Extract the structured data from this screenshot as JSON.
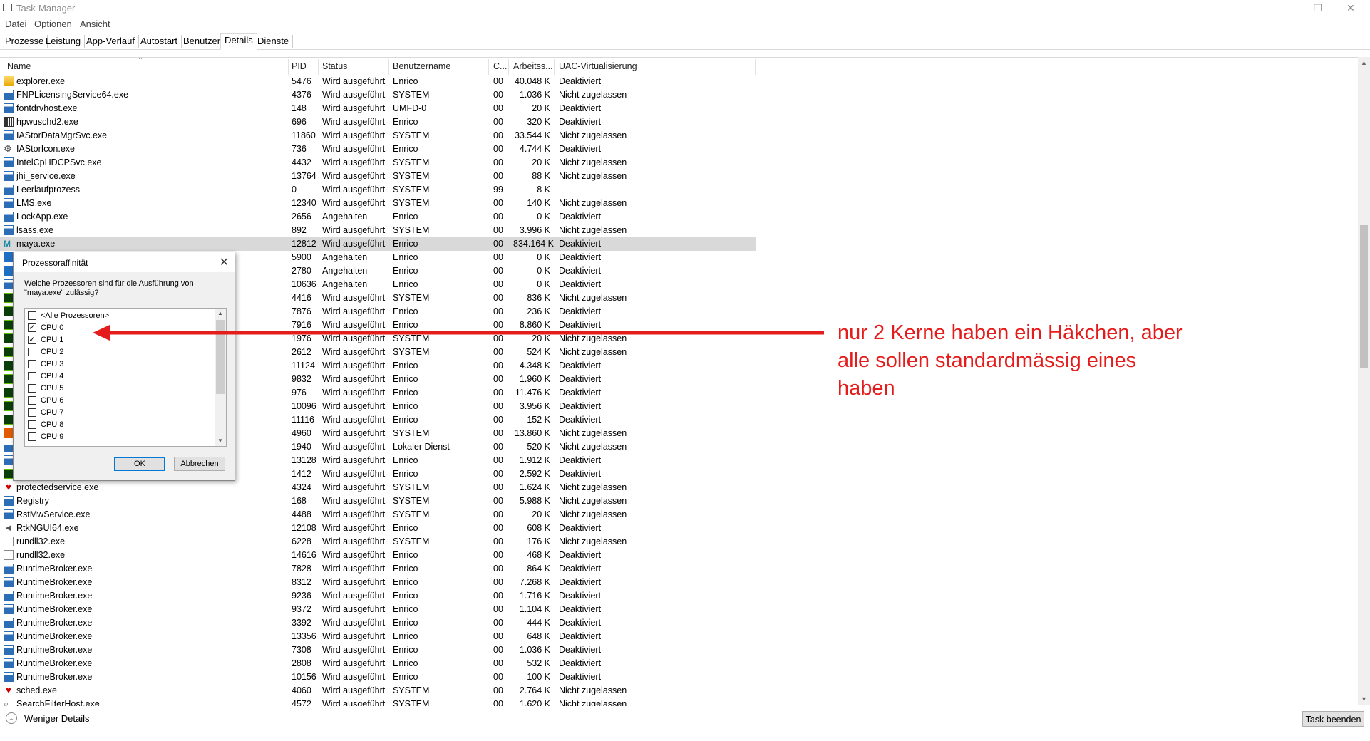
{
  "window": {
    "title": "Task-Manager",
    "minimize": "—",
    "restore": "❐",
    "close": "✕"
  },
  "menu": [
    "Datei",
    "Optionen",
    "Ansicht"
  ],
  "tabs": [
    "Prozesse",
    "Leistung",
    "App-Verlauf",
    "Autostart",
    "Benutzer",
    "Details",
    "Dienste"
  ],
  "active_tab": "Details",
  "columns": [
    "Name",
    "PID",
    "Status",
    "Benutzername",
    "C...",
    "Arbeitss...",
    "UAC-Virtualisierung"
  ],
  "processes": [
    {
      "icon": "folder-icon",
      "name": "explorer.exe",
      "pid": "5476",
      "status": "Wird ausgeführt",
      "user": "Enrico",
      "cpu": "00",
      "mem": "40.048 K",
      "uac": "Deaktiviert"
    },
    {
      "icon": "app-icon",
      "name": "FNPLicensingService64.exe",
      "pid": "4376",
      "status": "Wird ausgeführt",
      "user": "SYSTEM",
      "cpu": "00",
      "mem": "1.036 K",
      "uac": "Nicht zugelassen"
    },
    {
      "icon": "app-icon",
      "name": "fontdrvhost.exe",
      "pid": "148",
      "status": "Wird ausgeführt",
      "user": "UMFD-0",
      "cpu": "00",
      "mem": "20 K",
      "uac": "Deaktiviert"
    },
    {
      "icon": "printer-icon",
      "name": "hpwuschd2.exe",
      "pid": "696",
      "status": "Wird ausgeführt",
      "user": "Enrico",
      "cpu": "00",
      "mem": "320 K",
      "uac": "Deaktiviert"
    },
    {
      "icon": "app-icon",
      "name": "IAStorDataMgrSvc.exe",
      "pid": "11860",
      "status": "Wird ausgeführt",
      "user": "SYSTEM",
      "cpu": "00",
      "mem": "33.544 K",
      "uac": "Nicht zugelassen"
    },
    {
      "icon": "gear-icon",
      "name": "IAStorIcon.exe",
      "pid": "736",
      "status": "Wird ausgeführt",
      "user": "Enrico",
      "cpu": "00",
      "mem": "4.744 K",
      "uac": "Deaktiviert"
    },
    {
      "icon": "app-icon",
      "name": "IntelCpHDCPSvc.exe",
      "pid": "4432",
      "status": "Wird ausgeführt",
      "user": "SYSTEM",
      "cpu": "00",
      "mem": "20 K",
      "uac": "Nicht zugelassen"
    },
    {
      "icon": "app-icon",
      "name": "jhi_service.exe",
      "pid": "13764",
      "status": "Wird ausgeführt",
      "user": "SYSTEM",
      "cpu": "00",
      "mem": "88 K",
      "uac": "Nicht zugelassen"
    },
    {
      "icon": "app-icon",
      "name": "Leerlaufprozess",
      "pid": "0",
      "status": "Wird ausgeführt",
      "user": "SYSTEM",
      "cpu": "99",
      "mem": "8 K",
      "uac": ""
    },
    {
      "icon": "app-icon",
      "name": "LMS.exe",
      "pid": "12340",
      "status": "Wird ausgeführt",
      "user": "SYSTEM",
      "cpu": "00",
      "mem": "140 K",
      "uac": "Nicht zugelassen"
    },
    {
      "icon": "app-icon",
      "name": "LockApp.exe",
      "pid": "2656",
      "status": "Angehalten",
      "user": "Enrico",
      "cpu": "00",
      "mem": "0 K",
      "uac": "Deaktiviert"
    },
    {
      "icon": "app-icon",
      "name": "lsass.exe",
      "pid": "892",
      "status": "Wird ausgeführt",
      "user": "SYSTEM",
      "cpu": "00",
      "mem": "3.996 K",
      "uac": "Nicht zugelassen"
    },
    {
      "icon": "maya-icon",
      "name": "maya.exe",
      "pid": "12812",
      "status": "Wird ausgeführt",
      "user": "Enrico",
      "cpu": "00",
      "mem": "834.164 K",
      "uac": "Deaktiviert",
      "selected": true
    },
    {
      "icon": "edge-icon",
      "name": "",
      "pid": "5900",
      "status": "Angehalten",
      "user": "Enrico",
      "cpu": "00",
      "mem": "0 K",
      "uac": "Deaktiviert"
    },
    {
      "icon": "edge-icon",
      "name": "",
      "pid": "2780",
      "status": "Angehalten",
      "user": "Enrico",
      "cpu": "00",
      "mem": "0 K",
      "uac": "Deaktiviert"
    },
    {
      "icon": "app-icon",
      "name": "",
      "pid": "10636",
      "status": "Angehalten",
      "user": "Enrico",
      "cpu": "00",
      "mem": "0 K",
      "uac": "Deaktiviert"
    },
    {
      "icon": "nvidia-icon",
      "name": "",
      "pid": "4416",
      "status": "Wird ausgeführt",
      "user": "SYSTEM",
      "cpu": "00",
      "mem": "836 K",
      "uac": "Nicht zugelassen"
    },
    {
      "icon": "nvidia-icon",
      "name": "",
      "pid": "7876",
      "status": "Wird ausgeführt",
      "user": "Enrico",
      "cpu": "00",
      "mem": "236 K",
      "uac": "Deaktiviert"
    },
    {
      "icon": "nvidia-icon",
      "name": "",
      "pid": "7916",
      "status": "Wird ausgeführt",
      "user": "Enrico",
      "cpu": "00",
      "mem": "8.860 K",
      "uac": "Deaktiviert"
    },
    {
      "icon": "nvidia-icon",
      "name": "",
      "pid": "1976",
      "status": "Wird ausgeführt",
      "user": "SYSTEM",
      "cpu": "00",
      "mem": "20 K",
      "uac": "Nicht zugelassen"
    },
    {
      "icon": "nvidia-icon",
      "name": "",
      "pid": "2612",
      "status": "Wird ausgeführt",
      "user": "SYSTEM",
      "cpu": "00",
      "mem": "524 K",
      "uac": "Nicht zugelassen"
    },
    {
      "icon": "nvidia-icon",
      "name": "",
      "pid": "11124",
      "status": "Wird ausgeführt",
      "user": "Enrico",
      "cpu": "00",
      "mem": "4.348 K",
      "uac": "Deaktiviert"
    },
    {
      "icon": "nvidia-icon",
      "name": "",
      "pid": "9832",
      "status": "Wird ausgeführt",
      "user": "Enrico",
      "cpu": "00",
      "mem": "1.960 K",
      "uac": "Deaktiviert"
    },
    {
      "icon": "nvidia-icon",
      "name": "",
      "pid": "976",
      "status": "Wird ausgeführt",
      "user": "Enrico",
      "cpu": "00",
      "mem": "11.476 K",
      "uac": "Deaktiviert"
    },
    {
      "icon": "nvidia-icon",
      "name": "",
      "pid": "10096",
      "status": "Wird ausgeführt",
      "user": "Enrico",
      "cpu": "00",
      "mem": "3.956 K",
      "uac": "Deaktiviert"
    },
    {
      "icon": "nvidia-icon",
      "name": "",
      "pid": "11116",
      "status": "Wird ausgeführt",
      "user": "Enrico",
      "cpu": "00",
      "mem": "152 K",
      "uac": "Deaktiviert"
    },
    {
      "icon": "office-icon",
      "name": "",
      "pid": "4960",
      "status": "Wird ausgeführt",
      "user": "SYSTEM",
      "cpu": "00",
      "mem": "13.860 K",
      "uac": "Nicht zugelassen"
    },
    {
      "icon": "app-icon",
      "name": "",
      "pid": "1940",
      "status": "Wird ausgeführt",
      "user": "Lokaler Dienst",
      "cpu": "00",
      "mem": "520 K",
      "uac": "Nicht zugelassen"
    },
    {
      "icon": "app-icon",
      "name": "",
      "pid": "13128",
      "status": "Wird ausgeführt",
      "user": "Enrico",
      "cpu": "00",
      "mem": "1.912 K",
      "uac": "Deaktiviert"
    },
    {
      "icon": "green-app-icon",
      "name": "",
      "pid": "1412",
      "status": "Wird ausgeführt",
      "user": "Enrico",
      "cpu": "00",
      "mem": "2.592 K",
      "uac": "Deaktiviert"
    },
    {
      "icon": "shield-icon",
      "name": "protectedservice.exe",
      "pid": "4324",
      "status": "Wird ausgeführt",
      "user": "SYSTEM",
      "cpu": "00",
      "mem": "1.624 K",
      "uac": "Nicht zugelassen"
    },
    {
      "icon": "app-icon",
      "name": "Registry",
      "pid": "168",
      "status": "Wird ausgeführt",
      "user": "SYSTEM",
      "cpu": "00",
      "mem": "5.988 K",
      "uac": "Nicht zugelassen"
    },
    {
      "icon": "app-icon",
      "name": "RstMwService.exe",
      "pid": "4488",
      "status": "Wird ausgeführt",
      "user": "SYSTEM",
      "cpu": "00",
      "mem": "20 K",
      "uac": "Nicht zugelassen"
    },
    {
      "icon": "speaker-icon",
      "name": "RtkNGUI64.exe",
      "pid": "12108",
      "status": "Wird ausgeführt",
      "user": "Enrico",
      "cpu": "00",
      "mem": "608 K",
      "uac": "Deaktiviert"
    },
    {
      "icon": "document-icon",
      "name": "rundll32.exe",
      "pid": "6228",
      "status": "Wird ausgeführt",
      "user": "SYSTEM",
      "cpu": "00",
      "mem": "176 K",
      "uac": "Nicht zugelassen"
    },
    {
      "icon": "document-icon",
      "name": "rundll32.exe",
      "pid": "14616",
      "status": "Wird ausgeführt",
      "user": "Enrico",
      "cpu": "00",
      "mem": "468 K",
      "uac": "Deaktiviert"
    },
    {
      "icon": "app-icon",
      "name": "RuntimeBroker.exe",
      "pid": "7828",
      "status": "Wird ausgeführt",
      "user": "Enrico",
      "cpu": "00",
      "mem": "864 K",
      "uac": "Deaktiviert"
    },
    {
      "icon": "app-icon",
      "name": "RuntimeBroker.exe",
      "pid": "8312",
      "status": "Wird ausgeführt",
      "user": "Enrico",
      "cpu": "00",
      "mem": "7.268 K",
      "uac": "Deaktiviert"
    },
    {
      "icon": "app-icon",
      "name": "RuntimeBroker.exe",
      "pid": "9236",
      "status": "Wird ausgeführt",
      "user": "Enrico",
      "cpu": "00",
      "mem": "1.716 K",
      "uac": "Deaktiviert"
    },
    {
      "icon": "app-icon",
      "name": "RuntimeBroker.exe",
      "pid": "9372",
      "status": "Wird ausgeführt",
      "user": "Enrico",
      "cpu": "00",
      "mem": "1.104 K",
      "uac": "Deaktiviert"
    },
    {
      "icon": "app-icon",
      "name": "RuntimeBroker.exe",
      "pid": "3392",
      "status": "Wird ausgeführt",
      "user": "Enrico",
      "cpu": "00",
      "mem": "444 K",
      "uac": "Deaktiviert"
    },
    {
      "icon": "app-icon",
      "name": "RuntimeBroker.exe",
      "pid": "13356",
      "status": "Wird ausgeführt",
      "user": "Enrico",
      "cpu": "00",
      "mem": "648 K",
      "uac": "Deaktiviert"
    },
    {
      "icon": "app-icon",
      "name": "RuntimeBroker.exe",
      "pid": "7308",
      "status": "Wird ausgeführt",
      "user": "Enrico",
      "cpu": "00",
      "mem": "1.036 K",
      "uac": "Deaktiviert"
    },
    {
      "icon": "app-icon",
      "name": "RuntimeBroker.exe",
      "pid": "2808",
      "status": "Wird ausgeführt",
      "user": "Enrico",
      "cpu": "00",
      "mem": "532 K",
      "uac": "Deaktiviert"
    },
    {
      "icon": "app-icon",
      "name": "RuntimeBroker.exe",
      "pid": "10156",
      "status": "Wird ausgeführt",
      "user": "Enrico",
      "cpu": "00",
      "mem": "100 K",
      "uac": "Deaktiviert"
    },
    {
      "icon": "shield-icon",
      "name": "sched.exe",
      "pid": "4060",
      "status": "Wird ausgeführt",
      "user": "SYSTEM",
      "cpu": "00",
      "mem": "2.764 K",
      "uac": "Nicht zugelassen"
    },
    {
      "icon": "search-icon",
      "name": "SearchFilterHost.exe",
      "pid": "4572",
      "status": "Wird ausgeführt",
      "user": "SYSTEM",
      "cpu": "00",
      "mem": "1.620 K",
      "uac": "Nicht zugelassen"
    }
  ],
  "dialog": {
    "title": "Prozessoraffinität",
    "prompt": "Welche Prozessoren sind für die Ausführung von \"maya.exe\" zulässig?",
    "options": [
      {
        "label": "<Alle Prozessoren>",
        "checked": false
      },
      {
        "label": "CPU 0",
        "checked": true
      },
      {
        "label": "CPU 1",
        "checked": true
      },
      {
        "label": "CPU 2",
        "checked": false
      },
      {
        "label": "CPU 3",
        "checked": false
      },
      {
        "label": "CPU 4",
        "checked": false
      },
      {
        "label": "CPU 5",
        "checked": false
      },
      {
        "label": "CPU 6",
        "checked": false
      },
      {
        "label": "CPU 7",
        "checked": false
      },
      {
        "label": "CPU 8",
        "checked": false
      },
      {
        "label": "CPU 9",
        "checked": false
      }
    ],
    "ok": "OK",
    "cancel": "Abbrechen"
  },
  "footer": {
    "less_details": "Weniger Details",
    "end_task": "Task beenden"
  },
  "annotation": {
    "lines": [
      "nur 2 Kerne haben ein Häkchen, aber",
      "alle sollen standardmässig eines",
      "haben"
    ],
    "color": "#e51c1c"
  }
}
